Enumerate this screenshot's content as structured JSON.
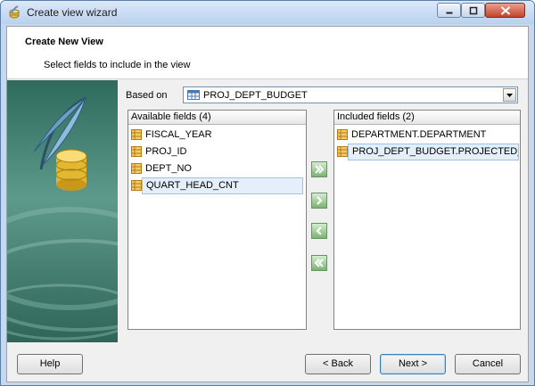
{
  "window": {
    "title": "Create view wizard"
  },
  "header": {
    "title": "Create New View",
    "subtitle": "Select fields to include in the view"
  },
  "based_on": {
    "label": "Based on",
    "value": "PROJ_DEPT_BUDGET"
  },
  "available": {
    "header": "Available fields (4)",
    "items": [
      "FISCAL_YEAR",
      "PROJ_ID",
      "DEPT_NO",
      "QUART_HEAD_CNT"
    ]
  },
  "included": {
    "header": "Included fields (2)",
    "items": [
      "DEPARTMENT.DEPARTMENT",
      "PROJ_DEPT_BUDGET.PROJECTED_BUD"
    ]
  },
  "buttons": {
    "help": "Help",
    "back": "< Back",
    "next": "Next >",
    "cancel": "Cancel"
  },
  "colors": {
    "accent": "#3c7fb1",
    "selection": "#e5eff9",
    "move_button": "#79b46e"
  }
}
